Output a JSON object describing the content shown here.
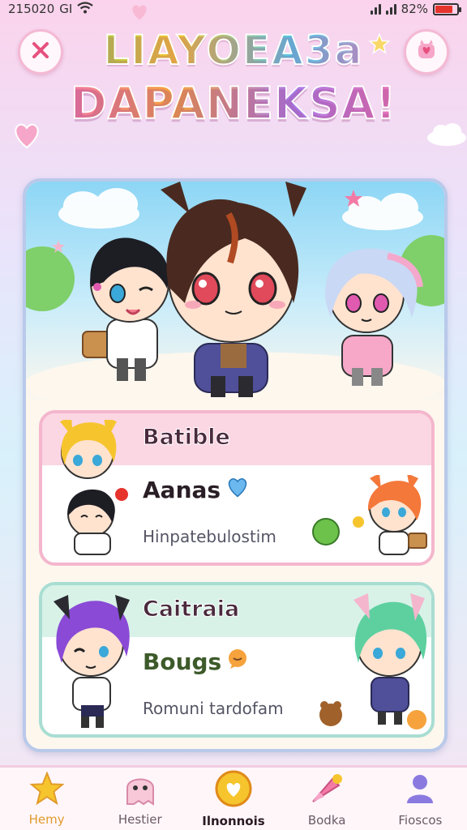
{
  "status_bar": {
    "time": "215020",
    "carrier": "GI",
    "battery_percent": "82%",
    "battery_level": 0.82
  },
  "header": {
    "logo_line1": "LIAYOEA3a",
    "logo_line2": "DAPANEKSA!"
  },
  "cards": [
    {
      "title": "Batible",
      "name": "Aanas",
      "subtitle": "Hinpatebulostim"
    },
    {
      "title": "Caitraia",
      "name": "Bougs",
      "subtitle": "Romuni tardofam"
    }
  ],
  "nav": {
    "items": [
      {
        "label": "Hemy",
        "icon": "star-icon"
      },
      {
        "label": "Hestier",
        "icon": "ghost-icon"
      },
      {
        "label": "Ilnonnois",
        "icon": "heart-badge-icon"
      },
      {
        "label": "Bodka",
        "icon": "rocket-icon"
      },
      {
        "label": "Fioscos",
        "icon": "person-icon"
      }
    ],
    "active_index": 2
  },
  "colors": {
    "accent_pink": "#f4b6cd",
    "accent_mint": "#a9ddd2",
    "panel_border": "#b9c9ea",
    "battery_red": "#e6342d"
  }
}
